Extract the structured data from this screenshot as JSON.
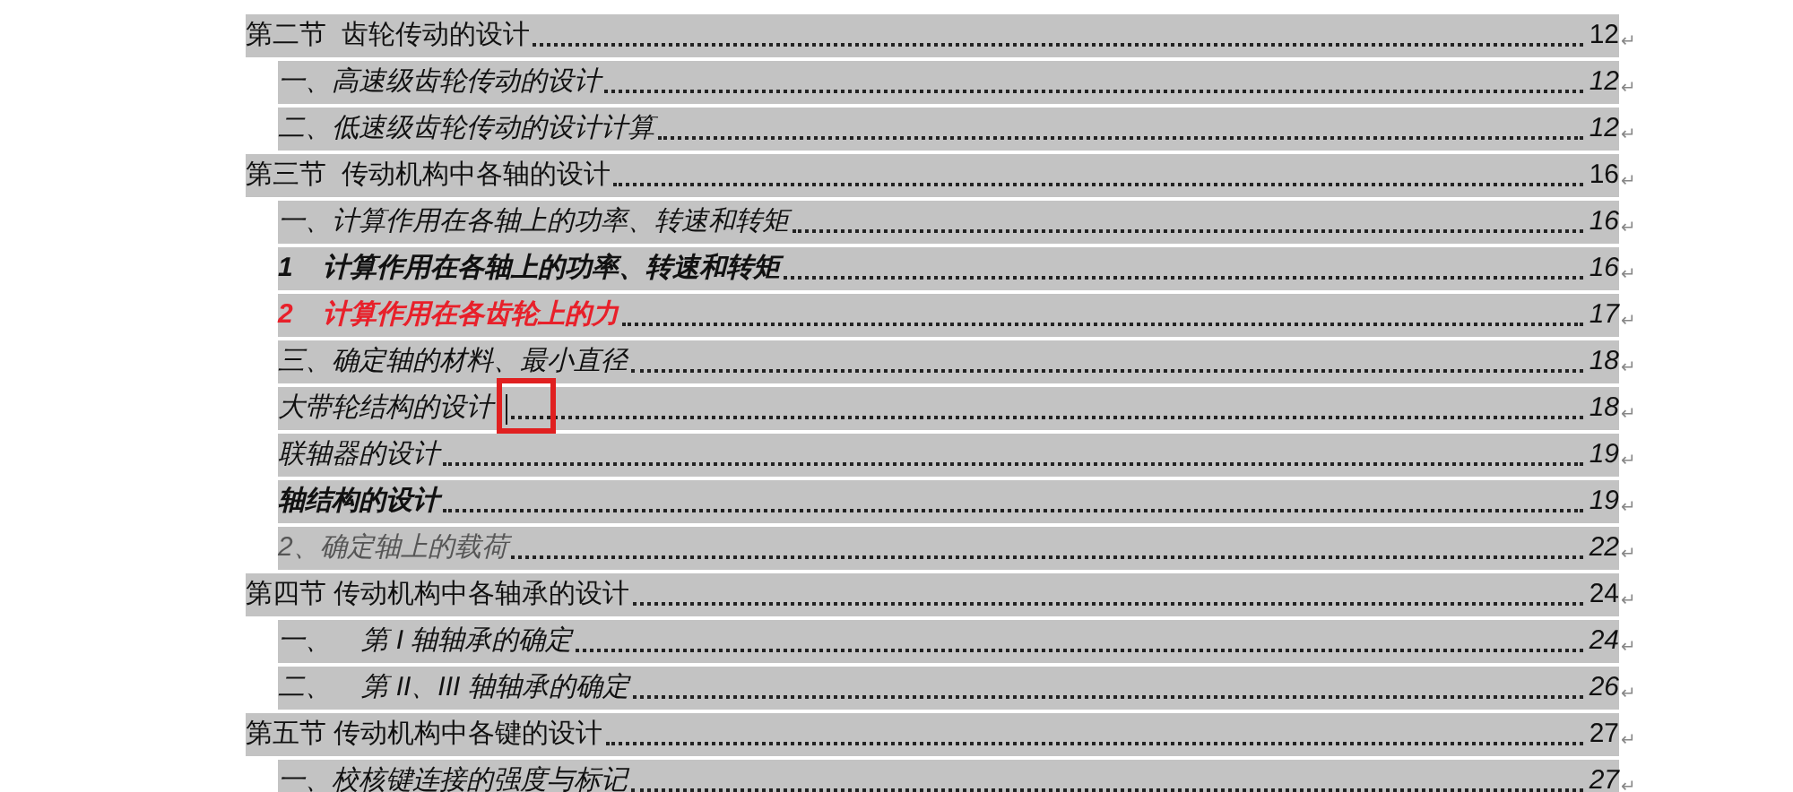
{
  "toc": [
    {
      "kind": "section",
      "title": "第二节  齿轮传动的设计",
      "page": "12",
      "end_mark": "↵",
      "cursor": false
    },
    {
      "kind": "entry",
      "title": "一、高速级齿轮传动的设计",
      "page": "12",
      "end_mark": "↵",
      "cursor": false
    },
    {
      "kind": "entry",
      "title": "二、低速级齿轮传动的设计计算",
      "page": "12",
      "end_mark": "↵",
      "cursor": false
    },
    {
      "kind": "section",
      "title": "第三节  传动机构中各轴的设计",
      "page": "16",
      "end_mark": "↵",
      "cursor": false
    },
    {
      "kind": "entry",
      "title": "一、计算作用在各轴上的功率、转速和转矩",
      "page": "16",
      "end_mark": "↵",
      "cursor": false
    },
    {
      "kind": "bold",
      "title": "1    计算作用在各轴上的功率、转速和转矩",
      "page": "16",
      "end_mark": "↵",
      "cursor": false
    },
    {
      "kind": "red",
      "title": "2    计算作用在各齿轮上的力",
      "page": "17",
      "end_mark": "↵",
      "cursor": false
    },
    {
      "kind": "entry",
      "title": "三、确定轴的材料、最小直径",
      "page": "18",
      "end_mark": "↵",
      "cursor": false
    },
    {
      "kind": "entry",
      "title": "大带轮结构的设计",
      "page": "18",
      "end_mark": "↵",
      "cursor": true
    },
    {
      "kind": "entry",
      "title": "联轴器的设计",
      "page": "19",
      "end_mark": "↵",
      "cursor": false
    },
    {
      "kind": "bold",
      "title": "轴结构的设计",
      "page": "19",
      "end_mark": "↵",
      "cursor": false
    },
    {
      "kind": "muted",
      "title": "2、确定轴上的载荷",
      "page": "22",
      "end_mark": "↵",
      "cursor": false
    },
    {
      "kind": "section",
      "title": "第四节 传动机构中各轴承的设计",
      "page": "24",
      "end_mark": "↵",
      "cursor": false
    },
    {
      "kind": "entry",
      "title": "一、    第 I 轴轴承的确定",
      "page": "24",
      "end_mark": "↵",
      "cursor": false
    },
    {
      "kind": "entry",
      "title": "二、    第 II、III 轴轴承的确定",
      "page": "26",
      "end_mark": "↵",
      "cursor": false
    },
    {
      "kind": "section",
      "title": "第五节 传动机构中各键的设计",
      "page": "27",
      "end_mark": "↵",
      "cursor": false
    },
    {
      "kind": "entry",
      "title": "一、校核键连接的强度与标记",
      "page": "27",
      "end_mark": "↵",
      "cursor": false
    }
  ]
}
